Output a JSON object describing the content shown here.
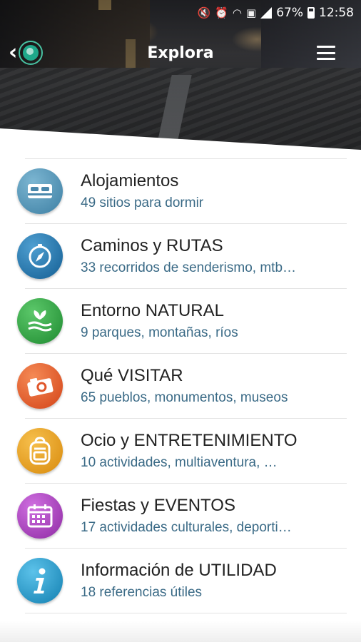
{
  "status_bar": {
    "battery": "67%",
    "time": "12:58",
    "icons": [
      "mute-icon",
      "alarm-icon",
      "wifi-icon",
      "nfc-icon",
      "signal-icon",
      "battery-icon"
    ]
  },
  "header": {
    "title": "Explora",
    "back_icon": "chevron-left-icon",
    "logo_icon": "globe-logo-icon",
    "menu_icon": "hamburger-menu-icon"
  },
  "categories": [
    {
      "title": "Alojamientos",
      "subtitle": "49 sitios para dormir",
      "icon": "bed-icon",
      "color": "#4a88ac"
    },
    {
      "title": "Caminos y RUTAS",
      "subtitle": "33 recorridos de senderismo, mtb…",
      "icon": "compass-icon",
      "color": "#1d6fa8"
    },
    {
      "title": "Entorno NATURAL",
      "subtitle": "9 parques, montañas, ríos",
      "icon": "leaf-water-icon",
      "color": "#2a9a3c"
    },
    {
      "title": "Qué VISITAR",
      "subtitle": "65 pueblos, monumentos, museos",
      "icon": "camera-icon",
      "color": "#e0562a"
    },
    {
      "title": "Ocio y ENTRETENIMIENTO",
      "subtitle": "10 actividades, multiaventura, …",
      "icon": "backpack-icon",
      "color": "#e39a1a"
    },
    {
      "title": "Fiestas y EVENTOS",
      "subtitle": "17 actividades culturales, deporti…",
      "icon": "calendar-icon",
      "color": "#a53db8"
    },
    {
      "title": "Información de UTILIDAD",
      "subtitle": "18 referencias útiles",
      "icon": "info-icon",
      "color": "#1e9ccf"
    }
  ]
}
